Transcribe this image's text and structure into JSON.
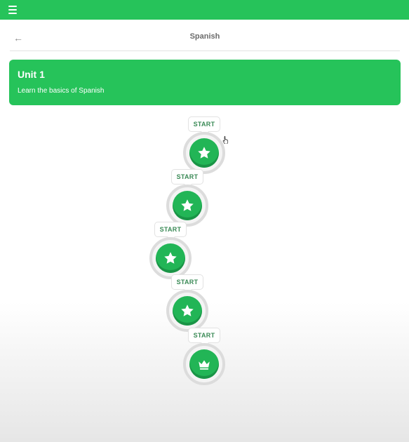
{
  "header": {
    "title": "Spanish"
  },
  "unit": {
    "title": "Unit 1",
    "description": "Learn the basics of Spanish"
  },
  "lessons": [
    {
      "start_label": "START",
      "icon": "star-icon"
    },
    {
      "start_label": "START",
      "icon": "star-icon"
    },
    {
      "start_label": "START",
      "icon": "star-icon"
    },
    {
      "start_label": "START",
      "icon": "star-icon"
    },
    {
      "start_label": "START",
      "icon": "crown-icon"
    }
  ],
  "colors": {
    "brand": "#26c35a",
    "lesson_button": "#22b556",
    "start_text": "#3a8a56"
  }
}
